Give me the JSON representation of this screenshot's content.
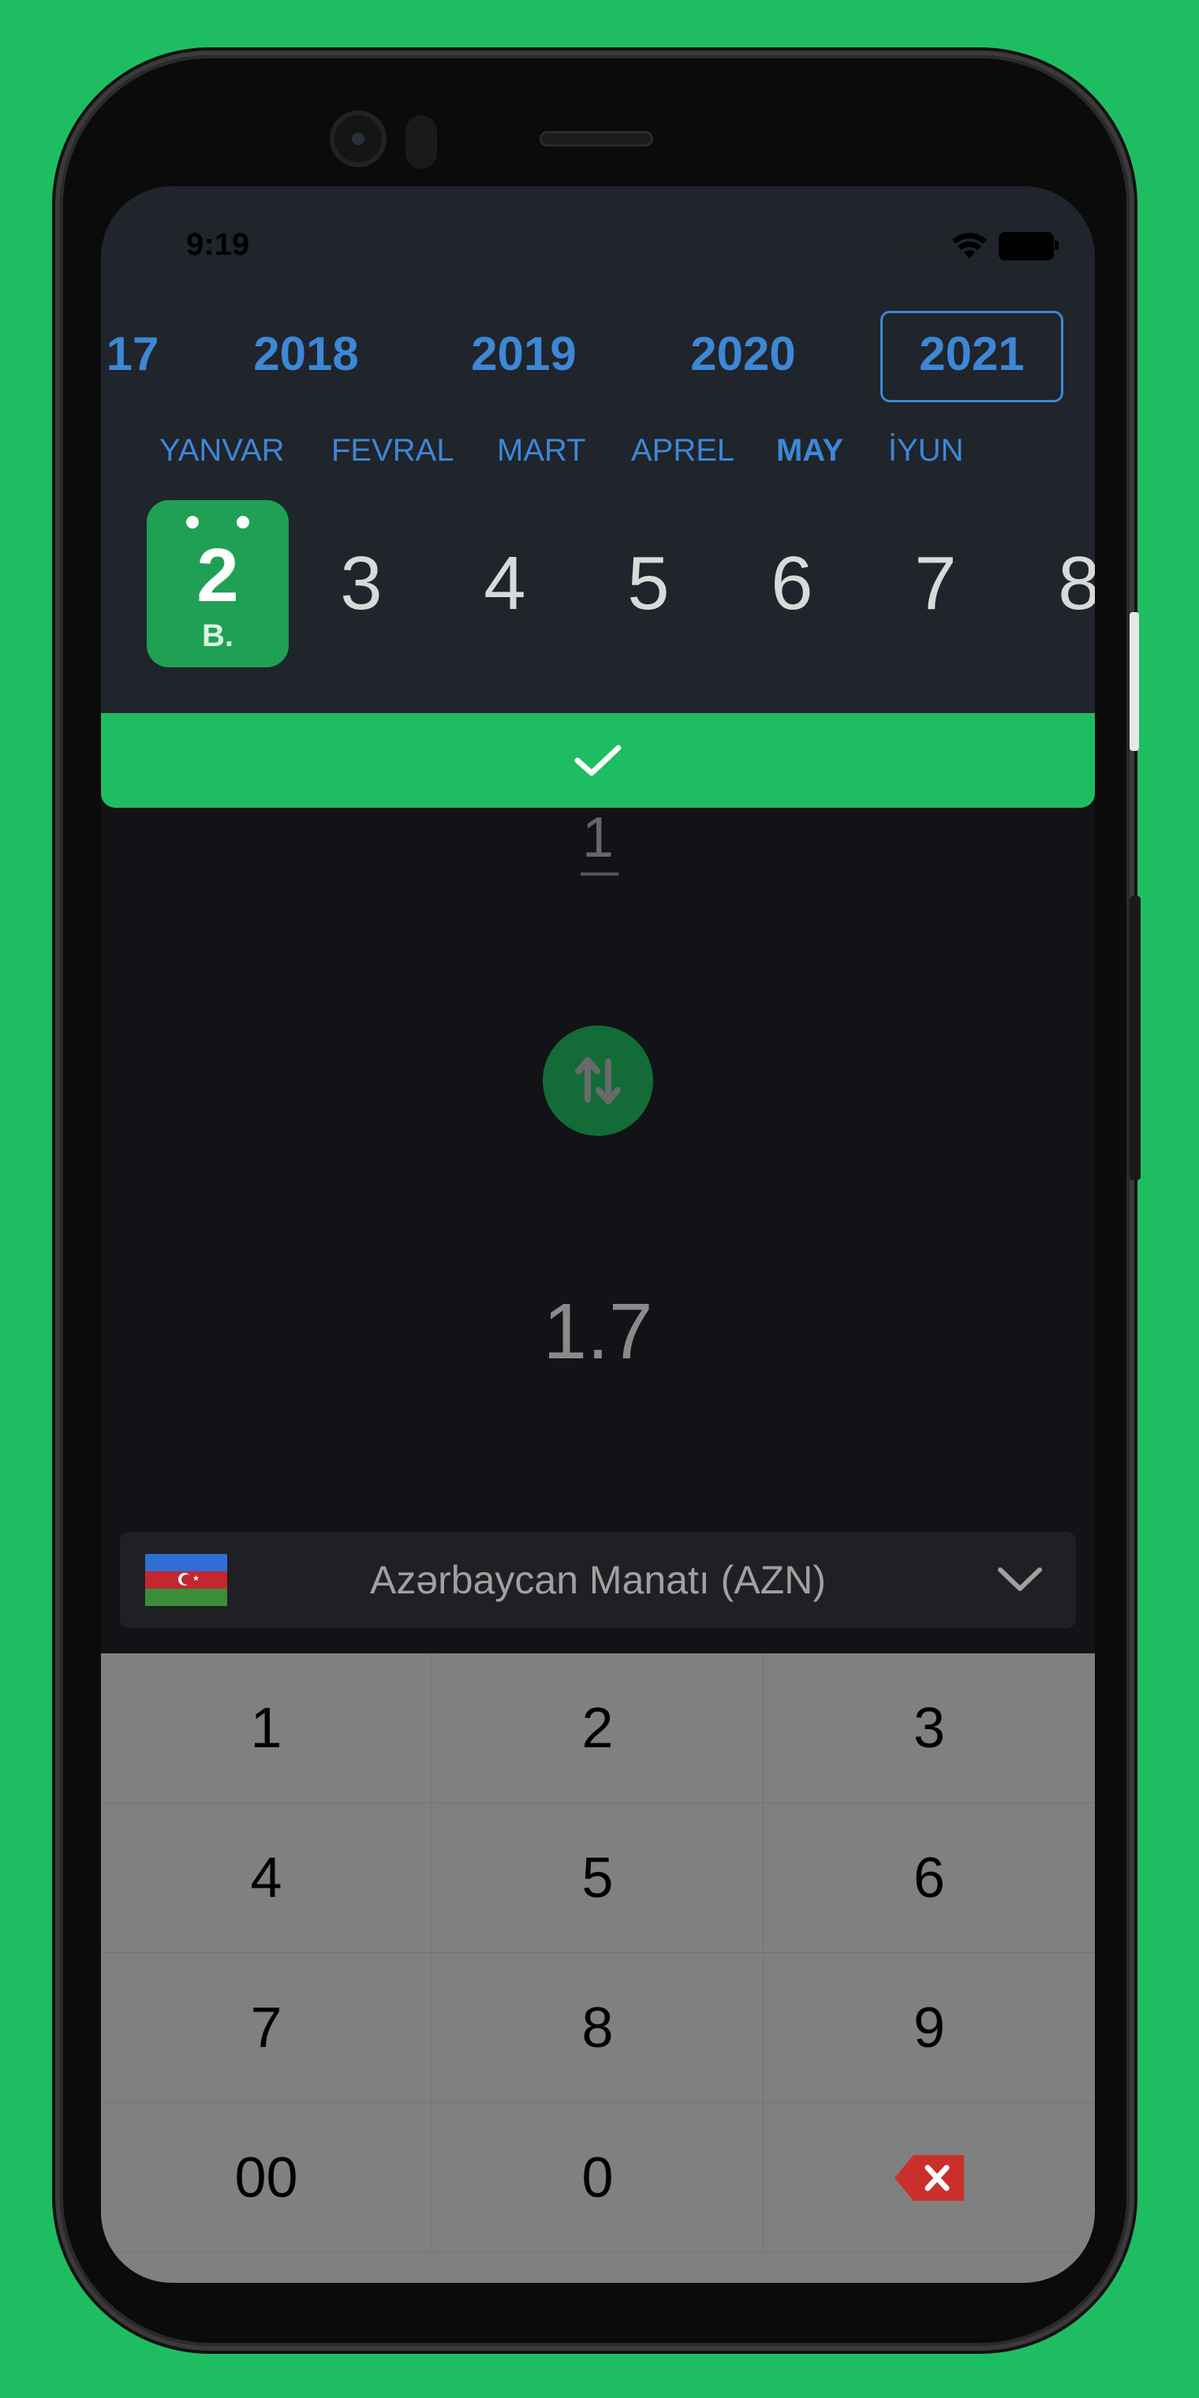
{
  "status_bar": {
    "time": "9:19"
  },
  "years": [
    "17",
    "2018",
    "2019",
    "2020",
    "2021"
  ],
  "selected_year": "2021",
  "months": [
    "YANVAR",
    "FEVRAL",
    "MART",
    "APREL",
    "MAY",
    "İYUN"
  ],
  "selected_month": "MAY",
  "days": {
    "selected": {
      "number": "2",
      "weekday": "B."
    },
    "others": [
      "3",
      "4",
      "5",
      "6",
      "7",
      "8"
    ]
  },
  "converter": {
    "input_value": "1",
    "result_value": "1.7"
  },
  "currency": {
    "name": "Azərbaycan Manatı (AZN)"
  },
  "keypad": {
    "keys": [
      "1",
      "2",
      "3",
      "4",
      "5",
      "6",
      "7",
      "8",
      "9",
      "00",
      "0"
    ],
    "backspace_icon": "backspace-icon"
  },
  "colors": {
    "accent_green": "#1fbd62",
    "link_blue": "#3d87d6",
    "panel_dark": "#20242b"
  }
}
